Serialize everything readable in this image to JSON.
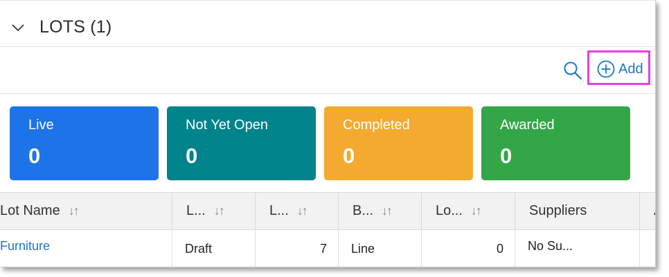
{
  "section": {
    "title": "LOTS (1)"
  },
  "toolbar": {
    "add_label": "Add"
  },
  "cards": [
    {
      "label": "Live",
      "count": "0",
      "color": "#1d73e8"
    },
    {
      "label": "Not Yet Open",
      "count": "0",
      "color": "#00838a"
    },
    {
      "label": "Completed",
      "count": "0",
      "color": "#f4aa2f"
    },
    {
      "label": "Awarded",
      "count": "0",
      "color": "#33a648"
    }
  ],
  "table": {
    "headers": [
      "Lot Name",
      "L...",
      "L...",
      "B...",
      "Lo...",
      "Suppliers",
      "A"
    ],
    "rows": [
      [
        "Furniture",
        "Draft",
        "7",
        "Line",
        "0",
        "No Su...",
        ""
      ]
    ]
  },
  "colors": {
    "link": "#1c74c8",
    "highlight": "#e63ee6"
  }
}
